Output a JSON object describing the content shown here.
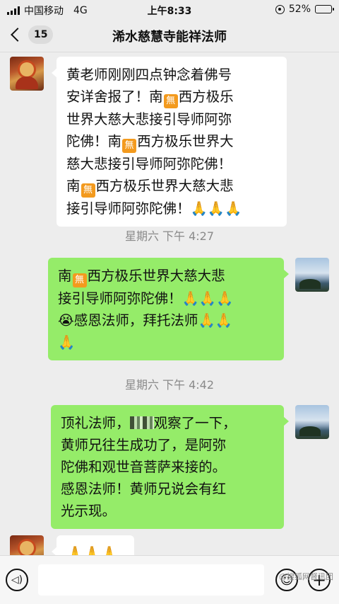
{
  "status_bar": {
    "carrier": "中国移动",
    "network": "4G",
    "time": "上午8:33",
    "battery": "52%",
    "battery_level": 0.52
  },
  "nav": {
    "back_badge": "15",
    "title": "浠水慈慧寺能祥法师"
  },
  "messages": [
    {
      "side": "left",
      "lines": [
        "黄老师刚刚四点钟念着佛号",
        "安详舍报了！南▣西方极乐",
        "世界大慈大悲接引导师阿弥",
        "陀佛！南▣西方极乐世界大",
        "慈大悲接引导师阿弥陀佛！",
        "南▣西方极乐世界大慈大悲",
        "接引导师阿弥陀佛！🙏🙏🙏"
      ]
    },
    {
      "timestamp": "星期六 下午 4:27"
    },
    {
      "side": "right",
      "lines": [
        "南▣西方极乐世界大慈大悲",
        "接引导师阿弥陀佛！🙏🙏🙏",
        "😭感恩法师，拜托法师🙏🙏",
        "🙏"
      ]
    },
    {
      "timestamp": "星期六 下午 4:42"
    },
    {
      "side": "right",
      "lines": [
        "顶礼法师，▦观察了一下，",
        "黄师兄往生成功了，是阿弥",
        "陀佛和观世音菩萨来接的。",
        "感恩法师！黄师兄说会有红",
        "光示现。"
      ]
    },
    {
      "side": "left",
      "lines": [
        "🙏🙏🙏"
      ]
    }
  ],
  "wu_char": "無",
  "watermark": "@搜狐网督讯团",
  "icons": {
    "voice": "voice-icon",
    "emoji": "emoji-icon",
    "plus": "plus-icon"
  },
  "colors": {
    "green_bubble": "#95ec69",
    "white_bubble": "#ffffff",
    "background": "#ededed"
  }
}
